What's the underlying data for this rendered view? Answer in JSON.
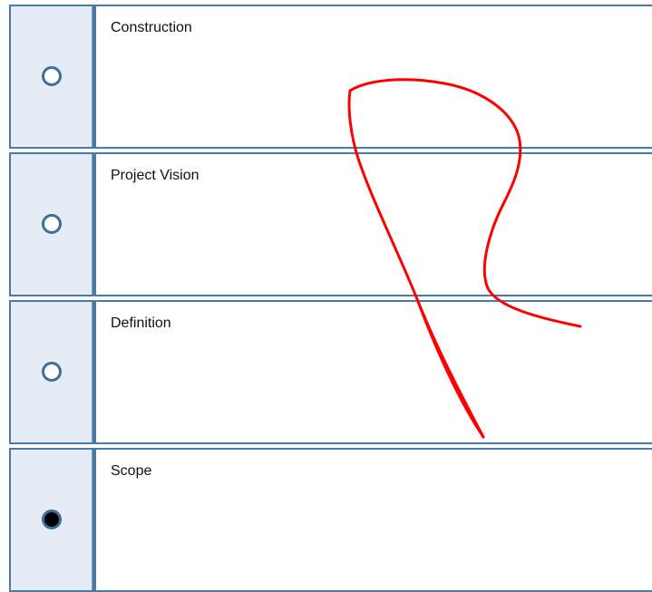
{
  "question": {
    "options": [
      {
        "label": "Construction",
        "selected": false
      },
      {
        "label": "Project Vision",
        "selected": false
      },
      {
        "label": "Definition",
        "selected": false
      },
      {
        "label": "Scope",
        "selected": true
      }
    ]
  },
  "colors": {
    "radio_column_bg": "#e6ecf5",
    "border": "#4a7ba6",
    "annotation": "#ff0000"
  }
}
